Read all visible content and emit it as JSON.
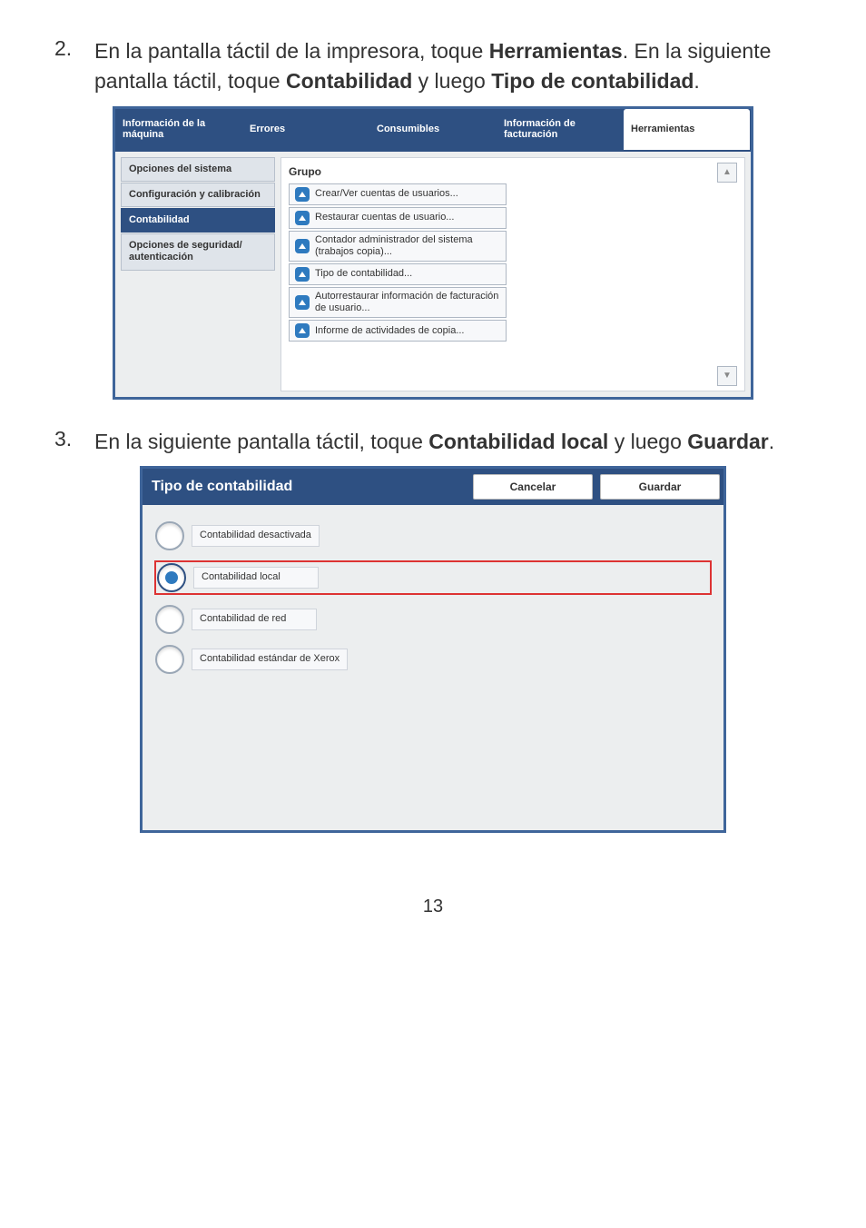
{
  "steps": {
    "s2": {
      "num": "2.",
      "text_parts": {
        "a": "En la pantalla táctil de la impresora, toque ",
        "b": "Herramientas",
        "c": ". En la siguiente pantalla táctil, toque ",
        "d": "Contabilidad",
        "e": " y luego ",
        "f": "Tipo de contabilidad",
        "g": "."
      }
    },
    "s3": {
      "num": "3.",
      "text_parts": {
        "a": "En la siguiente pantalla táctil, toque ",
        "b": "Contabilidad local",
        "c": " y luego ",
        "d": "Guardar",
        "e": "."
      }
    }
  },
  "sc1": {
    "tabs": {
      "info_maquina": "Información de la máquina",
      "errores": "Errores",
      "consumibles": "Consumibles",
      "info_facturacion": "Información de facturación",
      "herramientas": "Herramientas"
    },
    "sidebar": {
      "opciones_sistema": "Opciones del sistema",
      "config_calib": "Configuración y calibración",
      "contabilidad": "Contabilidad",
      "seguridad_auth": "Opciones de seguridad/ autenticación"
    },
    "grupo_header": "Grupo",
    "list": {
      "crear_ver": "Crear/Ver cuentas de usuarios...",
      "restaurar": "Restaurar cuentas de usuario...",
      "contador_admin": "Contador administrador del sistema (trabajos copia)...",
      "tipo_cont": "Tipo de contabilidad...",
      "autorrestaurar": "Autorrestaurar información de facturación de usuario...",
      "informe": "Informe de actividades de copia..."
    }
  },
  "sc2": {
    "title": "Tipo de contabilidad",
    "btn_cancel": "Cancelar",
    "btn_save": "Guardar",
    "options": {
      "desactivada": "Contabilidad desactivada",
      "local": "Contabilidad local",
      "red": "Contabilidad de red",
      "xerox": "Contabilidad estándar de Xerox"
    }
  },
  "page_number": "13"
}
